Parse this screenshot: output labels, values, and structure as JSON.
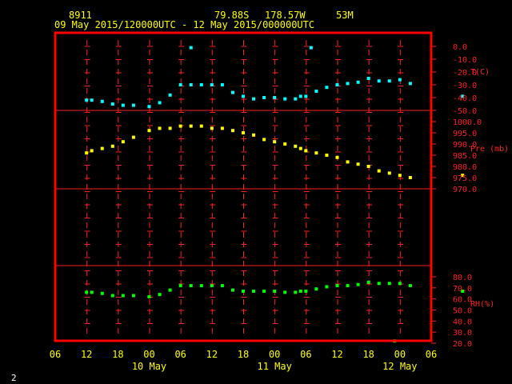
{
  "header": {
    "station": "8911",
    "lat": "79.88S",
    "lon": "178.57W",
    "elev": "53M",
    "range": "09 May 2015/120000UTC - 12 May 2015/000000UTC"
  },
  "footer": {
    "page": "2"
  },
  "colors": {
    "background": "#000000",
    "frame": "#ff0000",
    "grid": "#ff2020",
    "text": "#ffff00",
    "temperature": "#00ffff",
    "pressure": "#ffff00",
    "rh": "#00ff00"
  },
  "chart_data": [
    {
      "type": "scatter",
      "ylabel": "T(C)",
      "yticks": [
        0.0,
        -10.0,
        -20.0,
        -30.0,
        -40.0,
        -50.0
      ],
      "ytick_labels": [
        "0.0",
        "-10.0",
        "-20.0",
        "-30.0",
        "-40.0",
        "-50.0"
      ],
      "ylim": [
        -50,
        0
      ],
      "x": [
        12,
        13,
        15,
        17,
        19,
        21,
        24,
        26,
        28,
        32,
        34,
        36,
        38,
        40,
        42,
        44,
        46,
        48,
        50,
        52,
        53,
        54,
        55,
        56,
        58,
        60,
        62,
        64,
        66,
        68,
        70,
        72,
        76
      ],
      "values": [
        -42,
        -42,
        -43,
        -45,
        -46,
        -46,
        -47,
        -44,
        -38,
        -1,
        -30,
        -30,
        -30,
        -30,
        -30,
        -36,
        -39,
        -41,
        -40,
        -40,
        -41,
        -41,
        -39,
        -39,
        -35,
        -32,
        -30,
        -29,
        -28,
        -1,
        -25,
        -27,
        -27,
        -26,
        -29,
        -39
      ],
      "points": [
        [
          12,
          -42
        ],
        [
          13,
          -42
        ],
        [
          15,
          -43
        ],
        [
          17,
          -45
        ],
        [
          19,
          -46
        ],
        [
          21,
          -46
        ],
        [
          24,
          -47
        ],
        [
          26,
          -44
        ],
        [
          28,
          -38
        ],
        [
          32,
          -1
        ],
        [
          30,
          -30
        ],
        [
          32,
          -30
        ],
        [
          34,
          -30
        ],
        [
          36,
          -30
        ],
        [
          38,
          -30
        ],
        [
          40,
          -36
        ],
        [
          42,
          -39
        ],
        [
          44,
          -41
        ],
        [
          46,
          -40
        ],
        [
          48,
          -40
        ],
        [
          50,
          -41
        ],
        [
          52,
          -41
        ],
        [
          53,
          -39
        ],
        [
          54,
          -39
        ],
        [
          56,
          -35
        ],
        [
          58,
          -32
        ],
        [
          60,
          -30
        ],
        [
          62,
          -29
        ],
        [
          64,
          -28
        ],
        [
          55,
          -1
        ],
        [
          66,
          -25
        ],
        [
          68,
          -27
        ],
        [
          70,
          -27
        ],
        [
          72,
          -26
        ],
        [
          74,
          -29
        ],
        [
          84,
          -39
        ]
      ]
    },
    {
      "type": "scatter",
      "ylabel": "Pre (mb)",
      "yticks": [
        1000.0,
        995.0,
        990.0,
        985.0,
        980.0,
        975.0,
        970.0
      ],
      "ytick_labels": [
        "1000.0",
        "995.0",
        "990.0",
        "985.0",
        "980.0",
        "975.0",
        "970.0"
      ],
      "ylim": [
        970,
        1000
      ],
      "points": [
        [
          12,
          986
        ],
        [
          13,
          987
        ],
        [
          15,
          988
        ],
        [
          17,
          989
        ],
        [
          19,
          991
        ],
        [
          21,
          993
        ],
        [
          24,
          996
        ],
        [
          26,
          997
        ],
        [
          28,
          997
        ],
        [
          30,
          998
        ],
        [
          32,
          998
        ],
        [
          34,
          998
        ],
        [
          36,
          997
        ],
        [
          38,
          997
        ],
        [
          40,
          996
        ],
        [
          42,
          995
        ],
        [
          44,
          994
        ],
        [
          46,
          992
        ],
        [
          48,
          991
        ],
        [
          50,
          990
        ],
        [
          52,
          989
        ],
        [
          53,
          988
        ],
        [
          54,
          987
        ],
        [
          56,
          986
        ],
        [
          58,
          985
        ],
        [
          60,
          984
        ],
        [
          62,
          982
        ],
        [
          64,
          981
        ],
        [
          66,
          980
        ],
        [
          68,
          978
        ],
        [
          70,
          977
        ],
        [
          72,
          976
        ],
        [
          74,
          975
        ],
        [
          84,
          976
        ]
      ]
    },
    {
      "type": "scatter",
      "ylabel": "RH(%)",
      "yticks": [
        80.0,
        70.0,
        60.0,
        50.0,
        40.0,
        30.0,
        20.0
      ],
      "ytick_labels": [
        "80.0",
        "70.0",
        "60.0",
        "50.0",
        "40.0",
        "30.0",
        "20.0"
      ],
      "ylim": [
        20,
        80
      ],
      "points": [
        [
          12,
          66
        ],
        [
          13,
          66
        ],
        [
          15,
          65
        ],
        [
          17,
          63
        ],
        [
          19,
          63
        ],
        [
          21,
          63
        ],
        [
          24,
          62
        ],
        [
          26,
          64
        ],
        [
          28,
          68
        ],
        [
          30,
          72
        ],
        [
          32,
          72
        ],
        [
          34,
          72
        ],
        [
          36,
          72
        ],
        [
          38,
          72
        ],
        [
          40,
          68
        ],
        [
          42,
          67
        ],
        [
          44,
          67
        ],
        [
          46,
          67
        ],
        [
          48,
          67
        ],
        [
          50,
          66
        ],
        [
          52,
          66
        ],
        [
          53,
          67
        ],
        [
          54,
          67
        ],
        [
          56,
          69
        ],
        [
          58,
          71
        ],
        [
          60,
          72
        ],
        [
          62,
          72
        ],
        [
          64,
          73
        ],
        [
          66,
          75
        ],
        [
          68,
          74
        ],
        [
          70,
          74
        ],
        [
          72,
          74
        ],
        [
          74,
          72
        ],
        [
          71,
          22
        ],
        [
          84,
          67
        ]
      ]
    }
  ],
  "x_axis": {
    "ticks": [
      6,
      12,
      18,
      24,
      30,
      36,
      42,
      48,
      54,
      60,
      66,
      72,
      78,
      84,
      90
    ],
    "tick_labels": [
      "06",
      "12",
      "18",
      "00",
      "06",
      "12",
      "18",
      "00",
      "06",
      "12",
      "18",
      "00",
      "06"
    ],
    "tick_positions": [
      6,
      12,
      18,
      24,
      30,
      36,
      42,
      48,
      54,
      60,
      66,
      72,
      78
    ],
    "day_labels": [
      "10 May",
      "11 May",
      "12 May"
    ],
    "day_positions": [
      24,
      48,
      72
    ],
    "xlim": [
      6,
      78
    ]
  }
}
